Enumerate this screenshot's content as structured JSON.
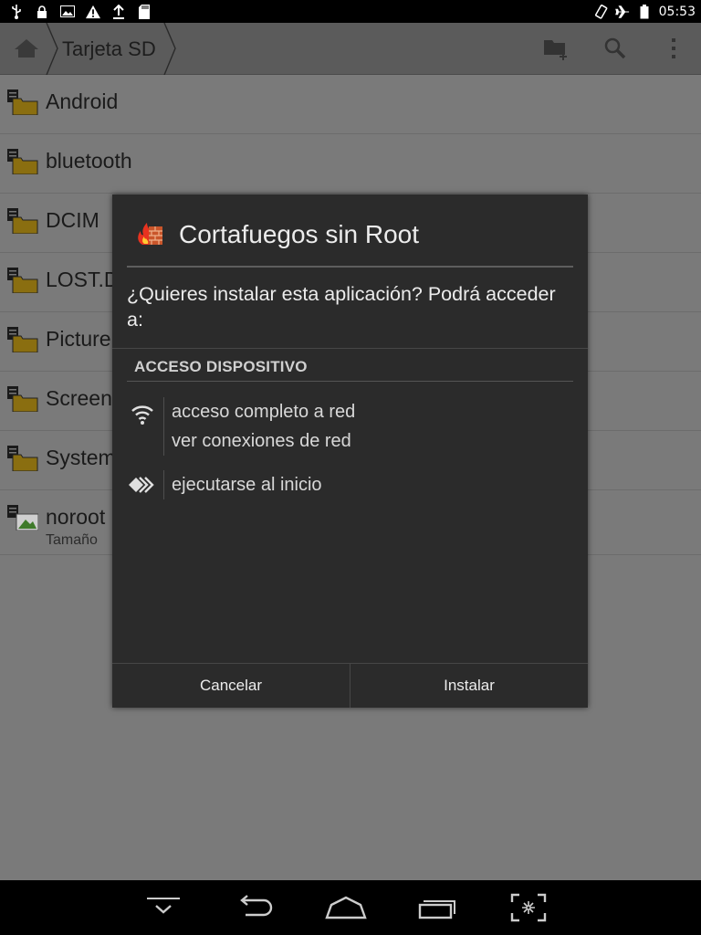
{
  "status_bar": {
    "time": "05:53",
    "left_icons": [
      "usb-icon",
      "lock-icon",
      "image-icon",
      "warning-icon",
      "upload-icon",
      "sd-card-icon"
    ],
    "right_icons": [
      "rotate-icon",
      "airplane-icon",
      "battery-icon"
    ]
  },
  "app_bar": {
    "breadcrumb": "Tarjeta SD",
    "actions": [
      "new-folder-icon",
      "search-icon",
      "overflow-menu-icon"
    ]
  },
  "files": [
    {
      "name": "Android",
      "type": "folder"
    },
    {
      "name": "bluetooth",
      "type": "folder"
    },
    {
      "name": "DCIM",
      "type": "folder"
    },
    {
      "name": "LOST.D",
      "type": "folder"
    },
    {
      "name": "Picture",
      "type": "folder"
    },
    {
      "name": "Screen",
      "type": "folder"
    },
    {
      "name": "System",
      "type": "folder"
    },
    {
      "name": "noroot",
      "subtitle": "Tamaño",
      "type": "apk"
    }
  ],
  "dialog": {
    "title": "Cortafuegos sin Root",
    "question": "¿Quieres instalar esta aplicación? Podrá acceder a:",
    "section": "ACCESO DISPOSITIVO",
    "permissions": [
      {
        "icon": "wifi-icon",
        "lines": [
          "acceso completo a red",
          "ver conexiones de red"
        ]
      },
      {
        "icon": "startup-icon",
        "lines": [
          "ejecutarse al inicio"
        ]
      }
    ],
    "cancel_label": "Cancelar",
    "install_label": "Instalar"
  },
  "colors": {
    "dialog_bg": "#2b2b2b",
    "dim_overlay": "#7a7a7a",
    "folder_yellow": "#9a7c12"
  }
}
